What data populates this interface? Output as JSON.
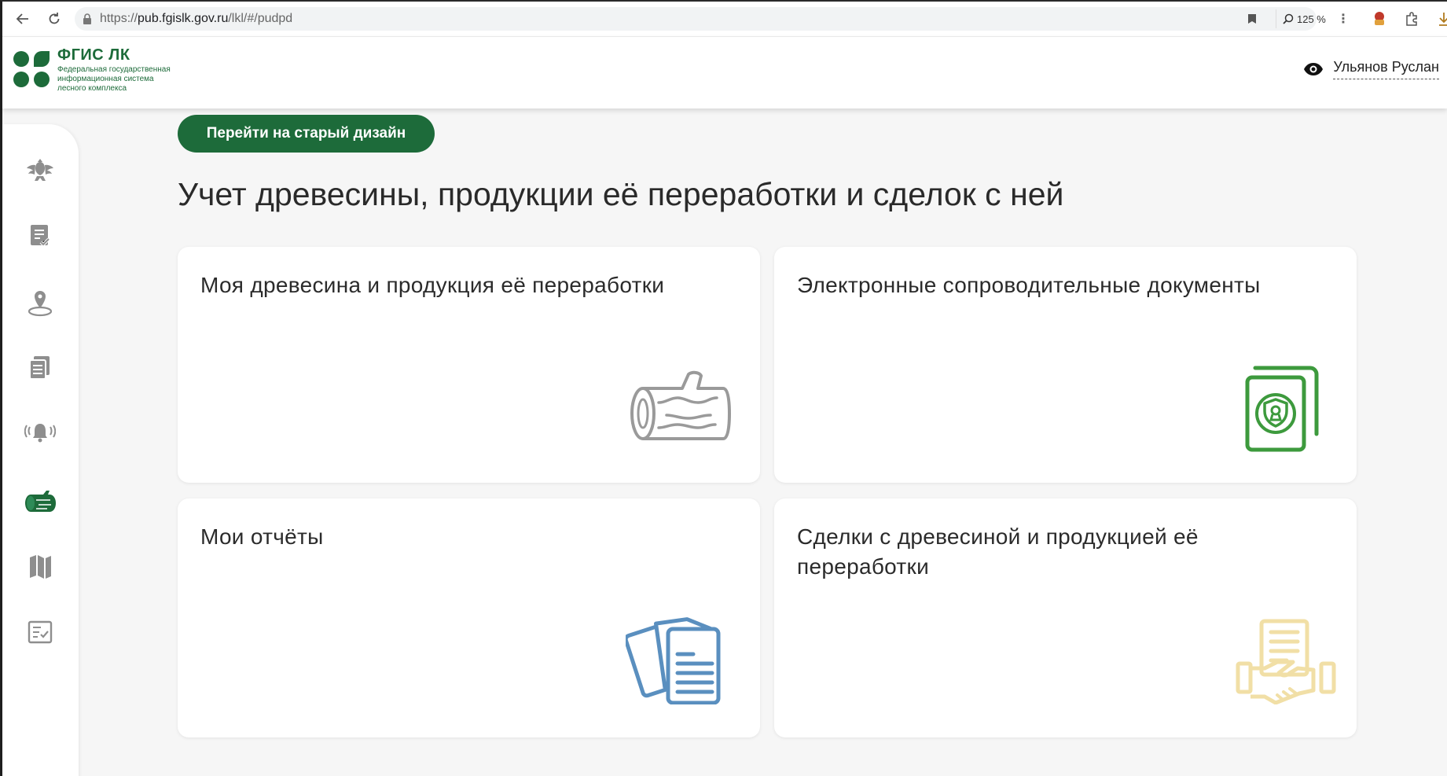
{
  "browser": {
    "url_prefix": "https://",
    "url_host": "pub.fgislk.gov.ru",
    "url_path": "/lkl/#/pudpd",
    "zoom": "125 %"
  },
  "header": {
    "logo_title": "ФГИС ЛК",
    "logo_sub_1": "Федеральная государственная",
    "logo_sub_2": "информационная система",
    "logo_sub_3": "лесного комплекса",
    "user_name": "Ульянов Руслан"
  },
  "sidebar": {
    "items": [
      {
        "icon": "emblem-icon"
      },
      {
        "icon": "document-check-icon"
      },
      {
        "icon": "location-pin-icon"
      },
      {
        "icon": "documents-stack-icon"
      },
      {
        "icon": "alarm-bell-icon"
      },
      {
        "icon": "timber-logs-icon",
        "active": true
      },
      {
        "icon": "map-icon"
      },
      {
        "icon": "checklist-icon"
      }
    ]
  },
  "main": {
    "old_design_button": "Перейти на старый дизайн",
    "title": "Учет древесины, продукции её переработки и сделок с ней",
    "cards": [
      {
        "title": "Моя древесина и продукция её переработки",
        "icon": "log-icon"
      },
      {
        "title": "Электронные сопроводительные документы",
        "icon": "shield-document-icon"
      },
      {
        "title": "Мои отчёты",
        "icon": "reports-icon"
      },
      {
        "title": "Сделки с древесиной и продукцией её переработки",
        "icon": "handshake-document-icon"
      }
    ]
  },
  "colors": {
    "brand_green": "#1d6b3a",
    "icon_green": "#3d9a3d",
    "icon_blue": "#5a8fbf",
    "icon_gray": "#9a9a9a",
    "icon_yellow": "#f1dfa6"
  }
}
